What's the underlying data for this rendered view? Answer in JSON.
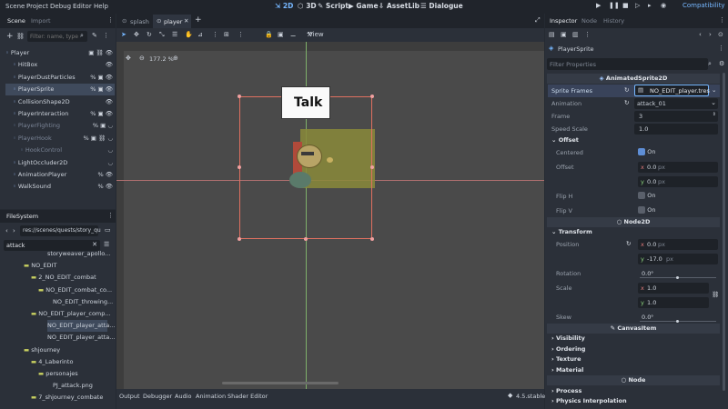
{
  "menu": [
    "Scene",
    "Project",
    "Debug",
    "Editor",
    "Help"
  ],
  "workspaces": [
    {
      "label": "2D",
      "icon": "2d-icon",
      "active": true
    },
    {
      "label": "3D",
      "icon": "3d-icon",
      "active": false
    },
    {
      "label": "Script",
      "icon": "script-icon",
      "active": false
    },
    {
      "label": "Game",
      "icon": "game-icon",
      "active": false
    },
    {
      "label": "AssetLib",
      "icon": "assetlib-icon",
      "active": false
    },
    {
      "label": "Dialogue",
      "icon": "dialogue-icon",
      "active": false
    }
  ],
  "renderer": "Compatibility",
  "scene_dock": {
    "tabs": [
      "Scene",
      "Import"
    ],
    "filter_placeholder": "Filter: name, type",
    "nodes": [
      {
        "label": "Player",
        "depth": 0,
        "icons": "▣ ⛓ 👁"
      },
      {
        "label": "HitBox",
        "depth": 1,
        "icons": "👁"
      },
      {
        "label": "PlayerDustParticles",
        "depth": 1,
        "icons": "% ▣ 👁"
      },
      {
        "label": "PlayerSprite",
        "depth": 1,
        "icons": "% ▣ 👁",
        "selected": true
      },
      {
        "label": "CollisionShape2D",
        "depth": 1,
        "icons": "👁"
      },
      {
        "label": "PlayerInteraction",
        "depth": 1,
        "icons": "% ▣ 👁"
      },
      {
        "label": "PlayerFighting",
        "depth": 1,
        "icons": "% ▣ ◡",
        "dim": true
      },
      {
        "label": "PlayerHook",
        "depth": 1,
        "icons": "% ▣ ⛓ ◡",
        "dim": true
      },
      {
        "label": "HookControl",
        "depth": 2,
        "icons": "◡",
        "dim": true
      },
      {
        "label": "LightOccluder2D",
        "depth": 1,
        "icons": "◡"
      },
      {
        "label": "AnimationPlayer",
        "depth": 1,
        "icons": "% 👁"
      },
      {
        "label": "WalkSound",
        "depth": 1,
        "icons": "% 👁"
      }
    ]
  },
  "filesystem": {
    "title": "FileSystem",
    "path": "res://scenes/quests/story_qu",
    "search": "attack",
    "rows": [
      {
        "label": "storyweaver_apollo...",
        "indent": 52,
        "type": "file"
      },
      {
        "label": "NO_EDIT",
        "indent": 26,
        "type": "folder"
      },
      {
        "label": "2_NO_EDIT_combat",
        "indent": 34,
        "type": "folder"
      },
      {
        "label": "NO_EDIT_combat_co...",
        "indent": 42,
        "type": "folder"
      },
      {
        "label": "NO_EDIT_throwing...",
        "indent": 58,
        "type": "file"
      },
      {
        "label": "NO_EDIT_player_comp...",
        "indent": 34,
        "type": "folder"
      },
      {
        "label": "NO_EDIT_player_atta...",
        "indent": 52,
        "type": "file",
        "selected": true
      },
      {
        "label": "NO_EDIT_player_atta...",
        "indent": 52,
        "type": "file"
      },
      {
        "label": "shjourney",
        "indent": 26,
        "type": "folder"
      },
      {
        "label": "4_Laberinto",
        "indent": 34,
        "type": "folder"
      },
      {
        "label": "personajes",
        "indent": 42,
        "type": "folder"
      },
      {
        "label": "PJ_attack.png",
        "indent": 58,
        "type": "file"
      },
      {
        "label": "7_shjourney_combate",
        "indent": 34,
        "type": "folder"
      }
    ]
  },
  "editor_tabs": [
    {
      "label": "splash",
      "active": false
    },
    {
      "label": "player",
      "active": true
    }
  ],
  "viewport": {
    "zoom": "177.2 %",
    "view_menu": "View",
    "talk_label": "Talk"
  },
  "bottom_tabs": [
    "Output",
    "Debugger",
    "Audio",
    "Animation",
    "Shader Editor"
  ],
  "version": "4.5.stable",
  "inspector": {
    "tabs": [
      "Inspector",
      "Node",
      "History"
    ],
    "node_name": "PlayerSprite",
    "filter_placeholder": "Filter Properties",
    "class_header": "AnimatedSprite2D",
    "sprite_frames_label": "Sprite Frames",
    "sprite_frames_value": "NO_EDIT_player.tres",
    "animation_label": "Animation",
    "animation_value": "attack_01",
    "frame_label": "Frame",
    "frame_value": "3",
    "speed_label": "Speed Scale",
    "speed_value": "1.0",
    "offset_section": "Offset",
    "centered_label": "Centered",
    "centered_value": "On",
    "offset_label": "Offset",
    "offset_x": "0.0",
    "offset_y": "0.0",
    "px_unit": "px",
    "fliph_label": "Flip H",
    "fliph_value": "On",
    "flipv_label": "Flip V",
    "flipv_value": "On",
    "node2d_header": "Node2D",
    "transform_section": "Transform",
    "position_label": "Position",
    "position_x": "0.0",
    "position_y": "-17.0",
    "rotation_label": "Rotation",
    "rotation_value": "0.0",
    "degree_unit": "°",
    "scale_label": "Scale",
    "scale_x": "1.0",
    "scale_y": "1.0",
    "skew_label": "Skew",
    "skew_value": "0.0",
    "canvasitem_header": "CanvasItem",
    "visibility_section": "Visibility",
    "ordering_section": "Ordering",
    "texture_section": "Texture",
    "material_section": "Material",
    "node_header": "Node",
    "process_section": "Process",
    "physics_section": "Physics Interpolation"
  },
  "colors": {
    "accent": "#76b7ff",
    "selection": "#3f4a5c",
    "viewport": "#4a4a4a"
  }
}
